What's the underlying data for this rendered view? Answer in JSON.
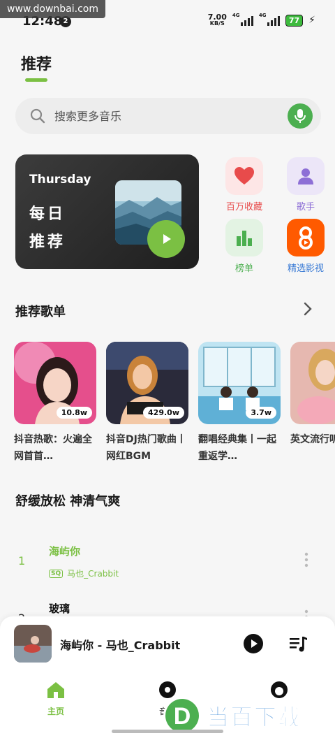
{
  "watermark": "www.downbai.com",
  "status": {
    "time": "12:48",
    "notification_count": "2",
    "net_speed": "7.00",
    "net_unit": "KB/S",
    "sig1": "4G",
    "sig2": "4G",
    "battery": "77"
  },
  "header": {
    "tab": "推荐"
  },
  "search": {
    "placeholder": "搜索更多音乐"
  },
  "daily": {
    "day": "Thursday",
    "title": "每日推荐"
  },
  "quick_links": [
    {
      "label": "百万收藏",
      "icon": "heart-icon",
      "color": "#e84b4b"
    },
    {
      "label": "歌手",
      "icon": "person-icon",
      "color": "#8d6fd6"
    },
    {
      "label": "榜单",
      "icon": "chart-bars-icon",
      "color": "#4caf50"
    },
    {
      "label": "精选影视",
      "icon": "video-icon",
      "color": "#ff5a00"
    }
  ],
  "sections": {
    "playlists_title": "推荐歌单",
    "relax_title": "舒缓放松 神清气爽"
  },
  "playlists": [
    {
      "count": "10.8w",
      "name": "抖音热歌：火遍全网首首…"
    },
    {
      "count": "429.0w",
      "name": "抖音DJ热门歌曲丨网红BGM"
    },
    {
      "count": "3.7w",
      "name": "翻唱经典集丨一起重返学…"
    },
    {
      "count": "",
      "name": "英文流行听又治愈"
    }
  ],
  "songs": [
    {
      "num": "1",
      "title": "海屿你",
      "artist": "马也_Crabbit",
      "badge": "SQ"
    },
    {
      "num": "2",
      "title": "玻璃",
      "artist": "",
      "badge": ""
    }
  ],
  "player": {
    "now_playing": "海屿你 - 马也_Crabbit"
  },
  "nav": [
    {
      "label": "主页",
      "active": true
    },
    {
      "label": "音乐",
      "active": false
    },
    {
      "label": "",
      "active": false
    }
  ],
  "brand": {
    "text": "当百下载",
    "letter": "D"
  },
  "colors": {
    "accent": "#7bc043",
    "mic": "#4caf50"
  }
}
